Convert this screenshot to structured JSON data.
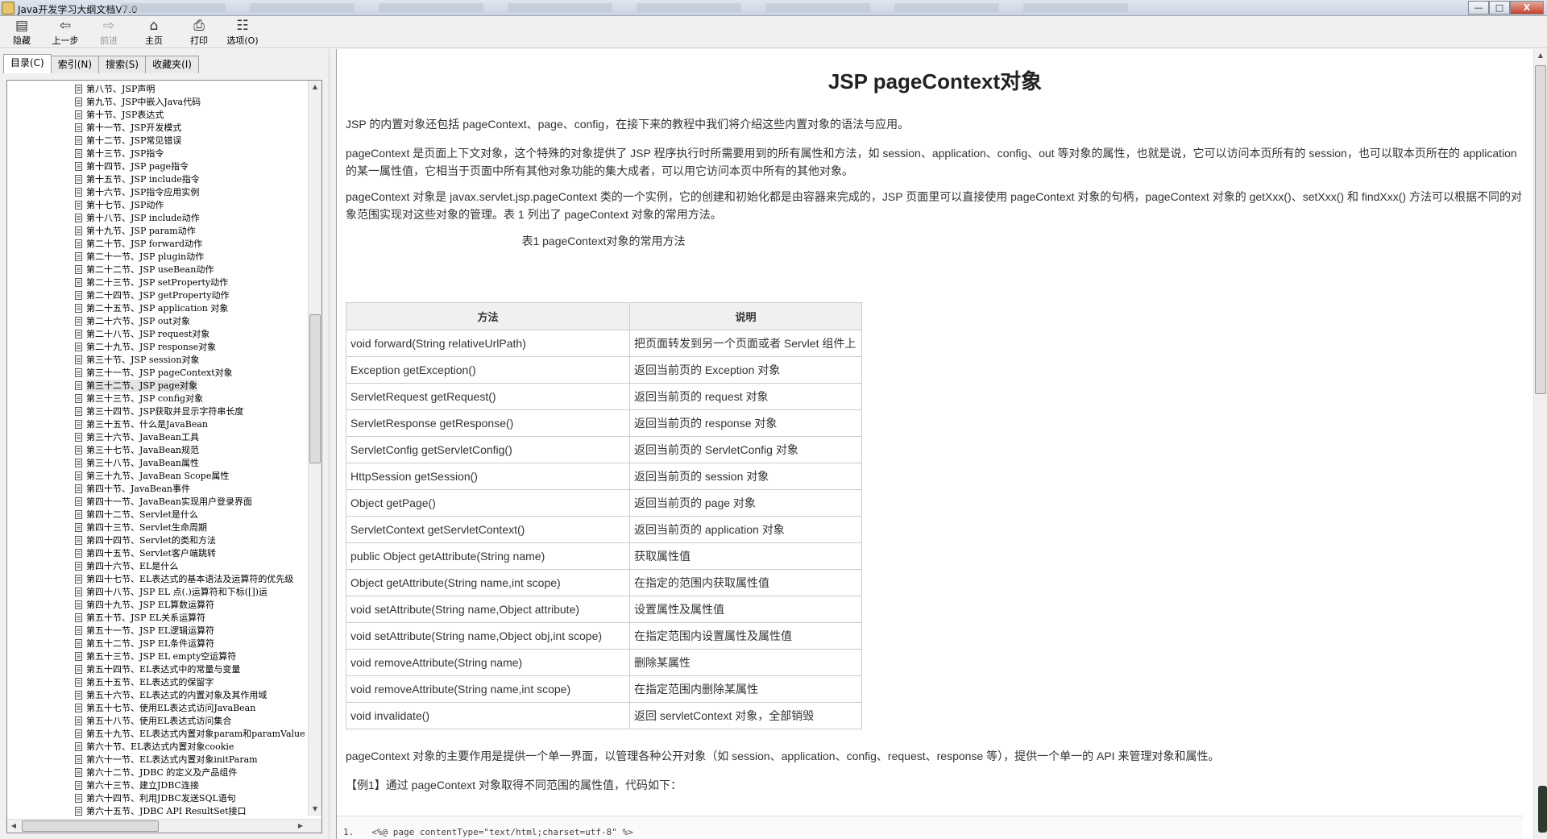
{
  "window": {
    "title": "Java开发学习大纲文档V7.0",
    "controls": [
      "—",
      "□",
      "X"
    ]
  },
  "toolbar": {
    "buttons": [
      {
        "label": "隐藏",
        "icon": "hide-icon"
      },
      {
        "label": "上一步",
        "icon": "back-arrow-icon"
      },
      {
        "label": "前进",
        "icon": "forward-arrow-icon",
        "disabled": true
      },
      {
        "label": "主页",
        "icon": "home-icon"
      },
      {
        "label": "打印",
        "icon": "print-icon"
      },
      {
        "label": "选项(O)",
        "icon": "options-icon"
      }
    ]
  },
  "nav_tabs": [
    "目录(C)",
    "索引(N)",
    "搜索(S)",
    "收藏夹(I)"
  ],
  "toc": {
    "selected_index": 23,
    "items": [
      "第八节、JSP声明",
      "第九节、JSP中嵌入Java代码",
      "第十节、JSP表达式",
      "第十一节、JSP开发模式",
      "第十二节、JSP常见错误",
      "第十三节、JSP指令",
      "第十四节、JSP page指令",
      "第十五节、JSP include指令",
      "第十六节、JSP指令应用实例",
      "第十七节、JSP动作",
      "第十八节、JSP include动作",
      "第十九节、JSP param动作",
      "第二十节、JSP forward动作",
      "第二十一节、JSP plugin动作",
      "第二十二节、JSP useBean动作",
      "第二十三节、JSP setProperty动作",
      "第二十四节、JSP getProperty动作",
      "第二十五节、JSP application 对象",
      "第二十六节、JSP out对象",
      "第二十八节、JSP request对象",
      "第二十九节、JSP response对象",
      "第三十节、JSP session对象",
      "第三十一节、JSP pageContext对象",
      "第三十二节、JSP page对象",
      "第三十三节、JSP config对象",
      "第三十四节、JSP获取并显示字符串长度",
      "第三十五节、什么是JavaBean",
      "第三十六节、JavaBean工具",
      "第三十七节、JavaBean规范",
      "第三十八节、JavaBean属性",
      "第三十九节、JavaBean Scope属性",
      "第四十节、JavaBean事件",
      "第四十一节、JavaBean实现用户登录界面",
      "第四十二节、Servlet是什么",
      "第四十三节、Servlet生命周期",
      "第四十四节、Servlet的类和方法",
      "第四十五节、Servlet客户端跳转",
      "第四十六节、EL是什么",
      "第四十七节、EL表达式的基本语法及运算符的优先级",
      "第四十八节、JSP EL 点(.)运算符和下标([])运",
      "第四十九节、JSP EL算数运算符",
      "第五十节、JSP EL关系运算符",
      "第五十一节、JSP EL逻辑运算符",
      "第五十二节、JSP EL条件运算符",
      "第五十三节、JSP EL empty空运算符",
      "第五十四节、EL表达式中的常量与变量",
      "第五十五节、EL表达式的保留字",
      "第五十六节、EL表达式的内置对象及其作用域",
      "第五十七节、使用EL表达式访问JavaBean",
      "第五十八节、使用EL表达式访问集合",
      "第五十九节、EL表达式内置对象param和paramValues",
      "第六十节、EL表达式内置对象cookie",
      "第六十一节、EL表达式内置对象initParam",
      "第六十二节、JDBC 的定义及产品组件",
      "第六十三节、建立JDBC连接",
      "第六十四节、利用JDBC发送SQL语句",
      "第六十五节、JDBC API ResultSet接口"
    ]
  },
  "article": {
    "title": "JSP pageContext对象",
    "paragraphs": [
      "JSP 的内置对象还包括 pageContext、page、config，在接下来的教程中我们将介绍这些内置对象的语法与应用。",
      "pageContext 是页面上下文对象，这个特殊的对象提供了 JSP 程序执行时所需要用到的所有属性和方法，如 session、application、config、out 等对象的属性，也就是说，它可以访问本页所有的 session，也可以取本页所在的 application 的某一属性值，它相当于页面中所有其他对象功能的集大成者，可以用它访问本页中所有的其他对象。",
      "pageContext 对象是 javax.servlet.jsp.pageContext 类的一个实例，它的创建和初始化都是由容器来完成的，JSP 页面里可以直接使用 pageContext 对象的句柄，pageContext 对象的 getXxx()、setXxx() 和 findXxx() 方法可以根据不同的对象范围实现对这些对象的管理。表 1 列出了 pageContext 对象的常用方法。"
    ],
    "table_caption": "表1 pageContext对象的常用方法",
    "table_headers": [
      "方法",
      "说明"
    ],
    "table_rows": [
      [
        "void forward(String relativeUrlPath)",
        "把页面转发到另一个页面或者 Servlet 组件上"
      ],
      [
        "Exception getException()",
        "返回当前页的 Exception 对象"
      ],
      [
        "ServletRequest getRequest()",
        "返回当前页的 request 对象"
      ],
      [
        "ServletResponse getResponse()",
        "返回当前页的 response 对象"
      ],
      [
        "ServletConfig getServletConfig()",
        "返回当前页的 ServletConfig 对象"
      ],
      [
        "HttpSession getSession()",
        "返回当前页的 session 对象"
      ],
      [
        "Object getPage()",
        "返回当前页的 page 对象"
      ],
      [
        "ServletContext getServletContext()",
        "返回当前页的 application 对象"
      ],
      [
        "public Object getAttribute(String name)",
        "获取属性值"
      ],
      [
        "Object getAttribute(String name,int scope)",
        "在指定的范围内获取属性值"
      ],
      [
        "void setAttribute(String name,Object attribute)",
        "设置属性及属性值"
      ],
      [
        "void setAttribute(String name,Object obj,int scope)",
        "在指定范围内设置属性及属性值"
      ],
      [
        "void removeAttribute(String name)",
        "删除某属性"
      ],
      [
        "void removeAttribute(String name,int scope)",
        "在指定范围内删除某属性"
      ],
      [
        "void invalidate()",
        "返回 servletContext 对象，全部销毁"
      ]
    ],
    "after_paragraph": "pageContext 对象的主要作用是提供一个单一界面，以管理各种公开对象（如 session、application、config、request、response 等），提供一个单一的 API 来管理对象和属性。",
    "example_paragraph": "【例1】通过 pageContext 对象取得不同范围的属性值，代码如下：",
    "code": {
      "line_number": "1.",
      "text": "<%@ page contentType=\"text/html;charset=utf-8\" %>"
    }
  }
}
